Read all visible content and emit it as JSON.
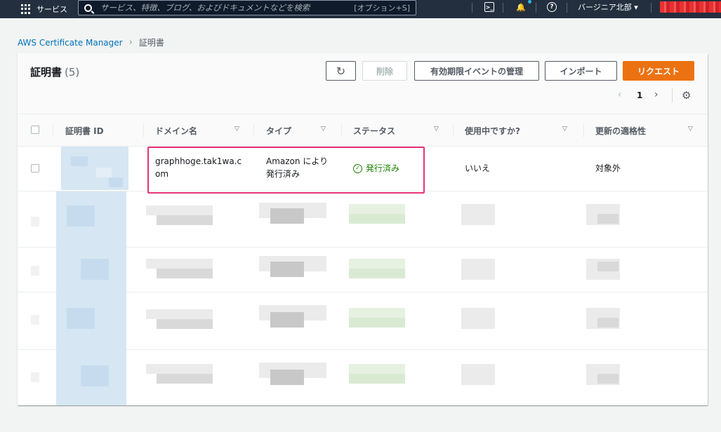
{
  "topnav": {
    "services_label": "サービス",
    "search_placeholder": "サービス、特徴、ブログ、およびドキュメントなどを検索",
    "search_shortcut": "[オプション+S]",
    "region_label": "バージニア北部 ▾",
    "terminal_glyph": ">_",
    "bell_glyph": "🔔",
    "help_glyph": "?"
  },
  "breadcrumb": {
    "root": "AWS Certificate Manager",
    "separator": "›",
    "current": "証明書"
  },
  "panel": {
    "title": "証明書",
    "count": "(5)",
    "buttons": {
      "refresh": "↻",
      "delete": "削除",
      "expiry_events": "有効期限イベントの管理",
      "import": "インポート",
      "request": "リクエスト"
    },
    "pager": {
      "prev": "‹",
      "page": "1",
      "next": "›",
      "settings": "⚙"
    }
  },
  "table": {
    "columns": [
      "証明書 ID",
      "ドメイン名",
      "タイプ",
      "ステータス",
      "使用中ですか?",
      "更新の適格性"
    ],
    "sort_glyph": "▽",
    "rows": [
      {
        "domain": "graphhoge.tak1wa.com",
        "domain_line1": "graphhoge.tak1wa.c",
        "domain_line2": "om",
        "type_line1": "Amazon により",
        "type_line2": "発行済み",
        "status": "発行済み",
        "status_glyph": "✓",
        "in_use": "いいえ",
        "renewal": "対象外"
      }
    ]
  },
  "colors": {
    "nav_bg": "#232f3e",
    "link": "#0073bb",
    "primary_button": "#ec7211",
    "success": "#1d8102",
    "highlight": "#e8317a"
  }
}
